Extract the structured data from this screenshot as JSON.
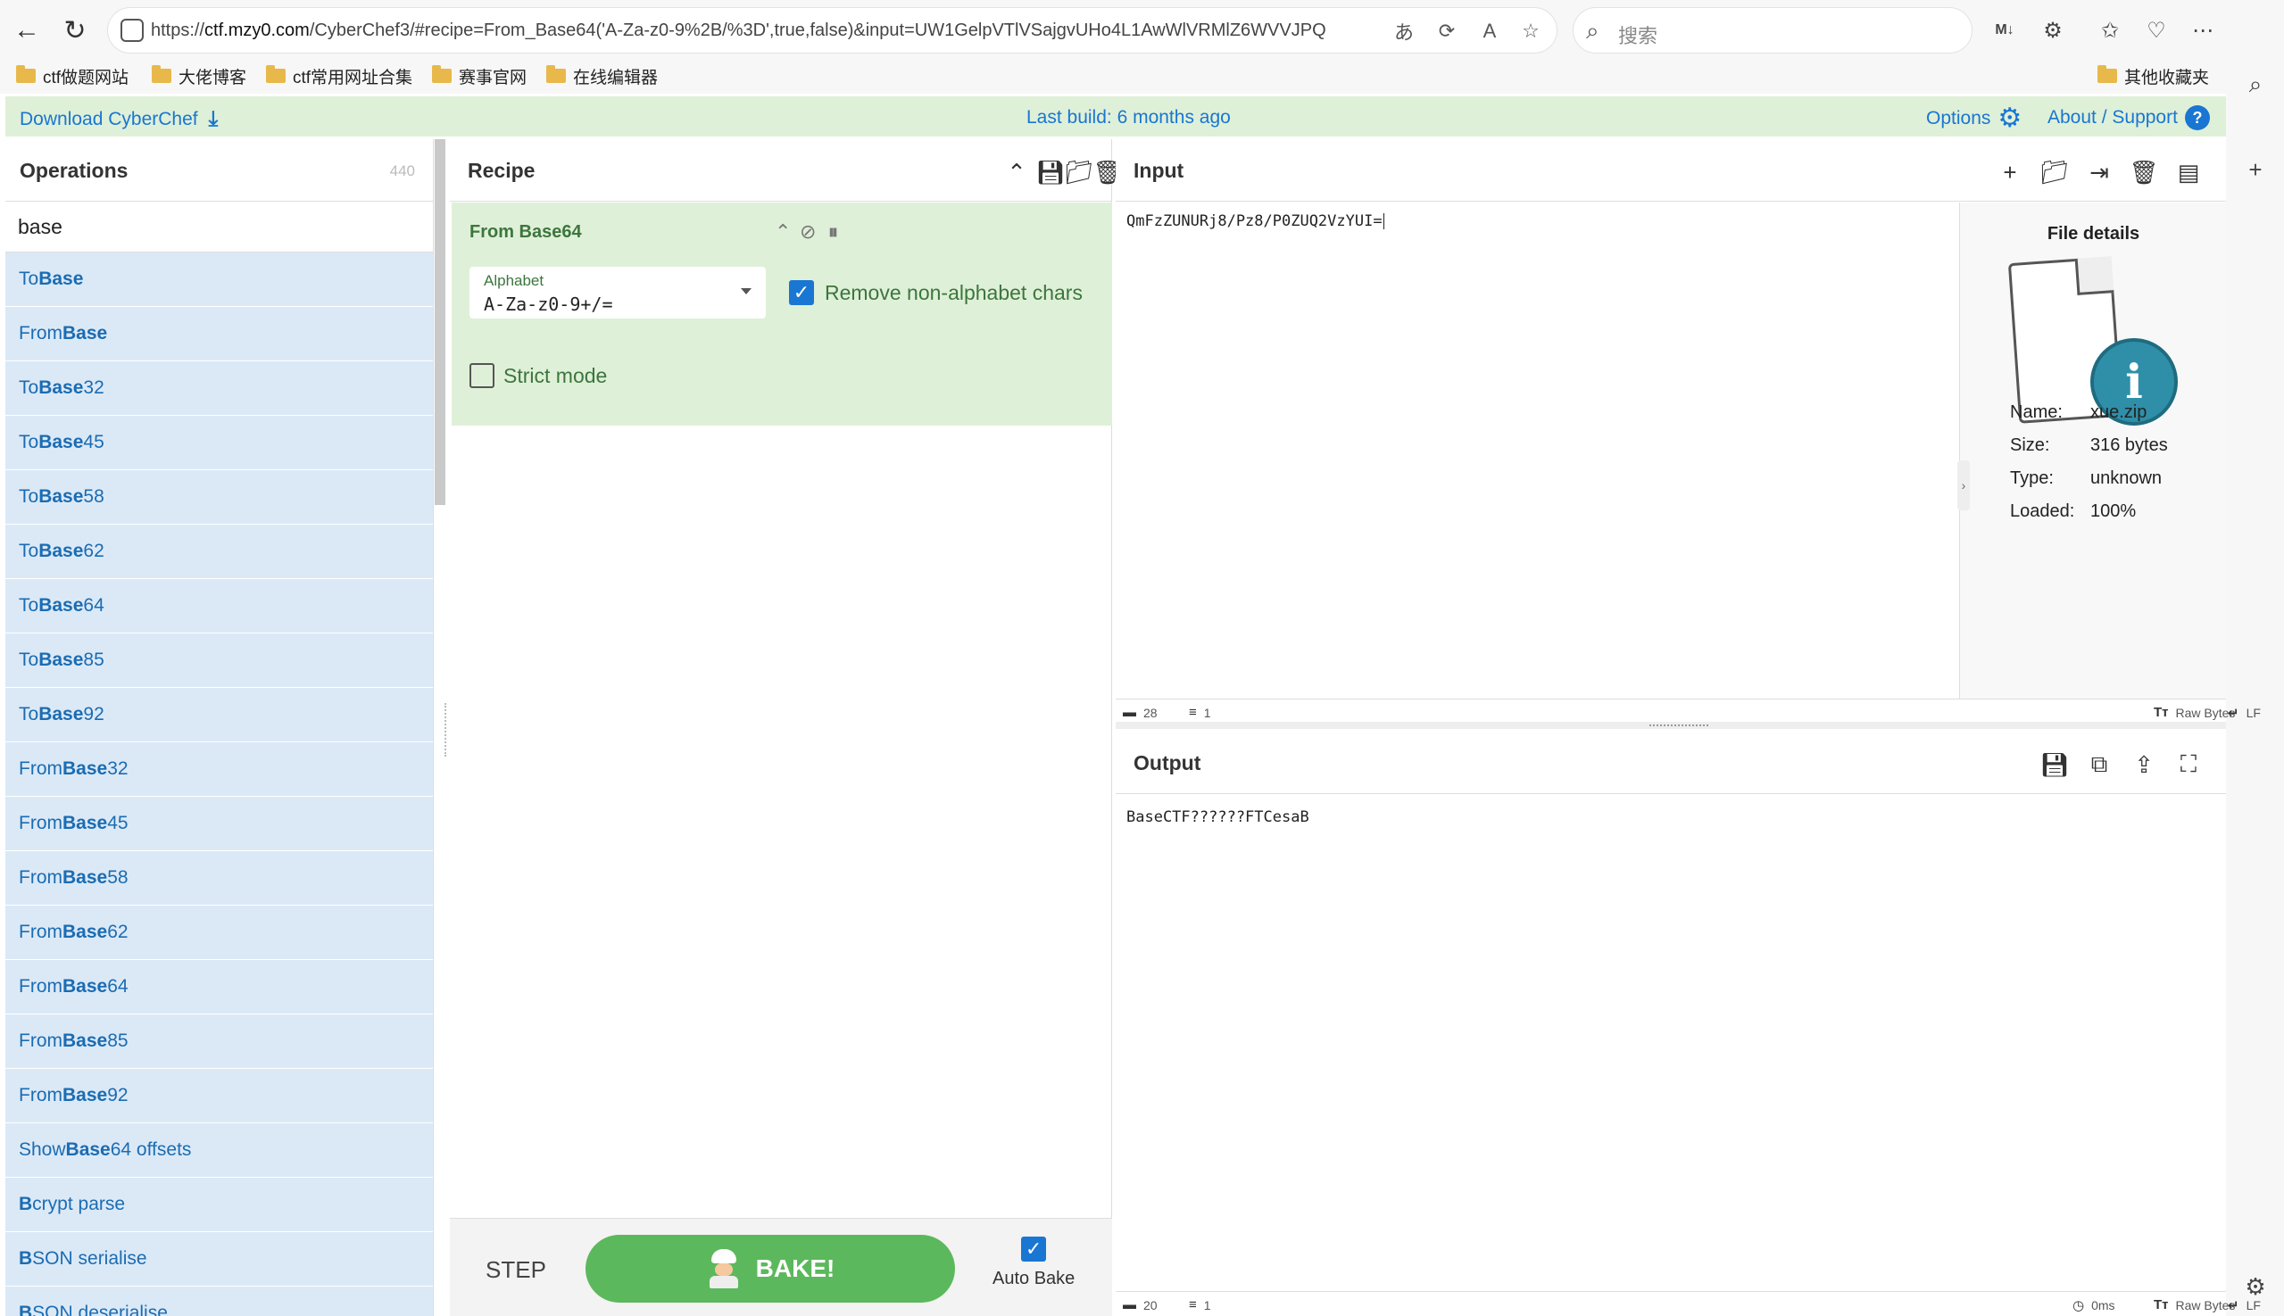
{
  "browser": {
    "url_prefix": "https://",
    "url_host": "ctf.mzy0.com",
    "url_rest": "/CyberChef3/#recipe=From_Base64('A-Za-z0-9%2B/%3D',true,false)&input=UW1GelpVTlVSajgvUHo4L1AwWlVRMlZ6WVVJPQ",
    "search_placeholder": "搜索",
    "bookmarks": [
      "ctf做题网站",
      "大佬博客",
      "ctf常用网址合集",
      "赛事官网",
      "在线编辑器"
    ],
    "other_bookmarks": "其他收藏夹"
  },
  "banner": {
    "download": "Download CyberChef",
    "build": "Last build: 6 months ago",
    "options": "Options",
    "about": "About / Support"
  },
  "operations": {
    "title": "Operations",
    "count": "440",
    "search_value": "base",
    "items": [
      {
        "pre": "To ",
        "hl": "Base",
        "post": ""
      },
      {
        "pre": "From ",
        "hl": "Base",
        "post": ""
      },
      {
        "pre": "To ",
        "hl": "Base",
        "post": "32"
      },
      {
        "pre": "To ",
        "hl": "Base",
        "post": "45"
      },
      {
        "pre": "To ",
        "hl": "Base",
        "post": "58"
      },
      {
        "pre": "To ",
        "hl": "Base",
        "post": "62"
      },
      {
        "pre": "To ",
        "hl": "Base",
        "post": "64"
      },
      {
        "pre": "To ",
        "hl": "Base",
        "post": "85"
      },
      {
        "pre": "To ",
        "hl": "Base",
        "post": "92"
      },
      {
        "pre": "From ",
        "hl": "Base",
        "post": "32"
      },
      {
        "pre": "From ",
        "hl": "Base",
        "post": "45"
      },
      {
        "pre": "From ",
        "hl": "Base",
        "post": "58"
      },
      {
        "pre": "From ",
        "hl": "Base",
        "post": "62"
      },
      {
        "pre": "From ",
        "hl": "Base",
        "post": "64"
      },
      {
        "pre": "From ",
        "hl": "Base",
        "post": "85"
      },
      {
        "pre": "From ",
        "hl": "Base",
        "post": "92"
      },
      {
        "pre": "Show ",
        "hl": "Base",
        "post": "64 offsets"
      },
      {
        "pre": "",
        "hl": "B",
        "post": "crypt parse"
      },
      {
        "pre": "",
        "hl": "B",
        "post": "SON serialise"
      },
      {
        "pre": "",
        "hl": "B",
        "post": "SON deserialise"
      }
    ]
  },
  "recipe": {
    "title": "Recipe",
    "op_title": "From Base64",
    "alphabet_label": "Alphabet",
    "alphabet_value": "A-Za-z0-9+/=",
    "remove_label": "Remove non-alphabet chars",
    "strict_label": "Strict mode",
    "step": "STEP",
    "bake": "BAKE!",
    "autobake": "Auto Bake"
  },
  "input": {
    "title": "Input",
    "text": "QmFzZUNURj8/Pz8/P0ZUQ2VzYUI=",
    "chars": "28",
    "lines": "1",
    "encoding": "Raw Bytes",
    "eol": "LF"
  },
  "file_details": {
    "title": "File details",
    "rows": [
      {
        "k": "Name:",
        "v": "xue.zip"
      },
      {
        "k": "Size:",
        "v": "316 bytes"
      },
      {
        "k": "Type:",
        "v": "unknown"
      },
      {
        "k": "Loaded:",
        "v": "100%"
      }
    ]
  },
  "output": {
    "title": "Output",
    "text": "BaseCTF??????FTCesaB",
    "chars": "20",
    "lines": "1",
    "time": "0ms",
    "encoding": "Raw Bytes",
    "eol": "LF"
  }
}
